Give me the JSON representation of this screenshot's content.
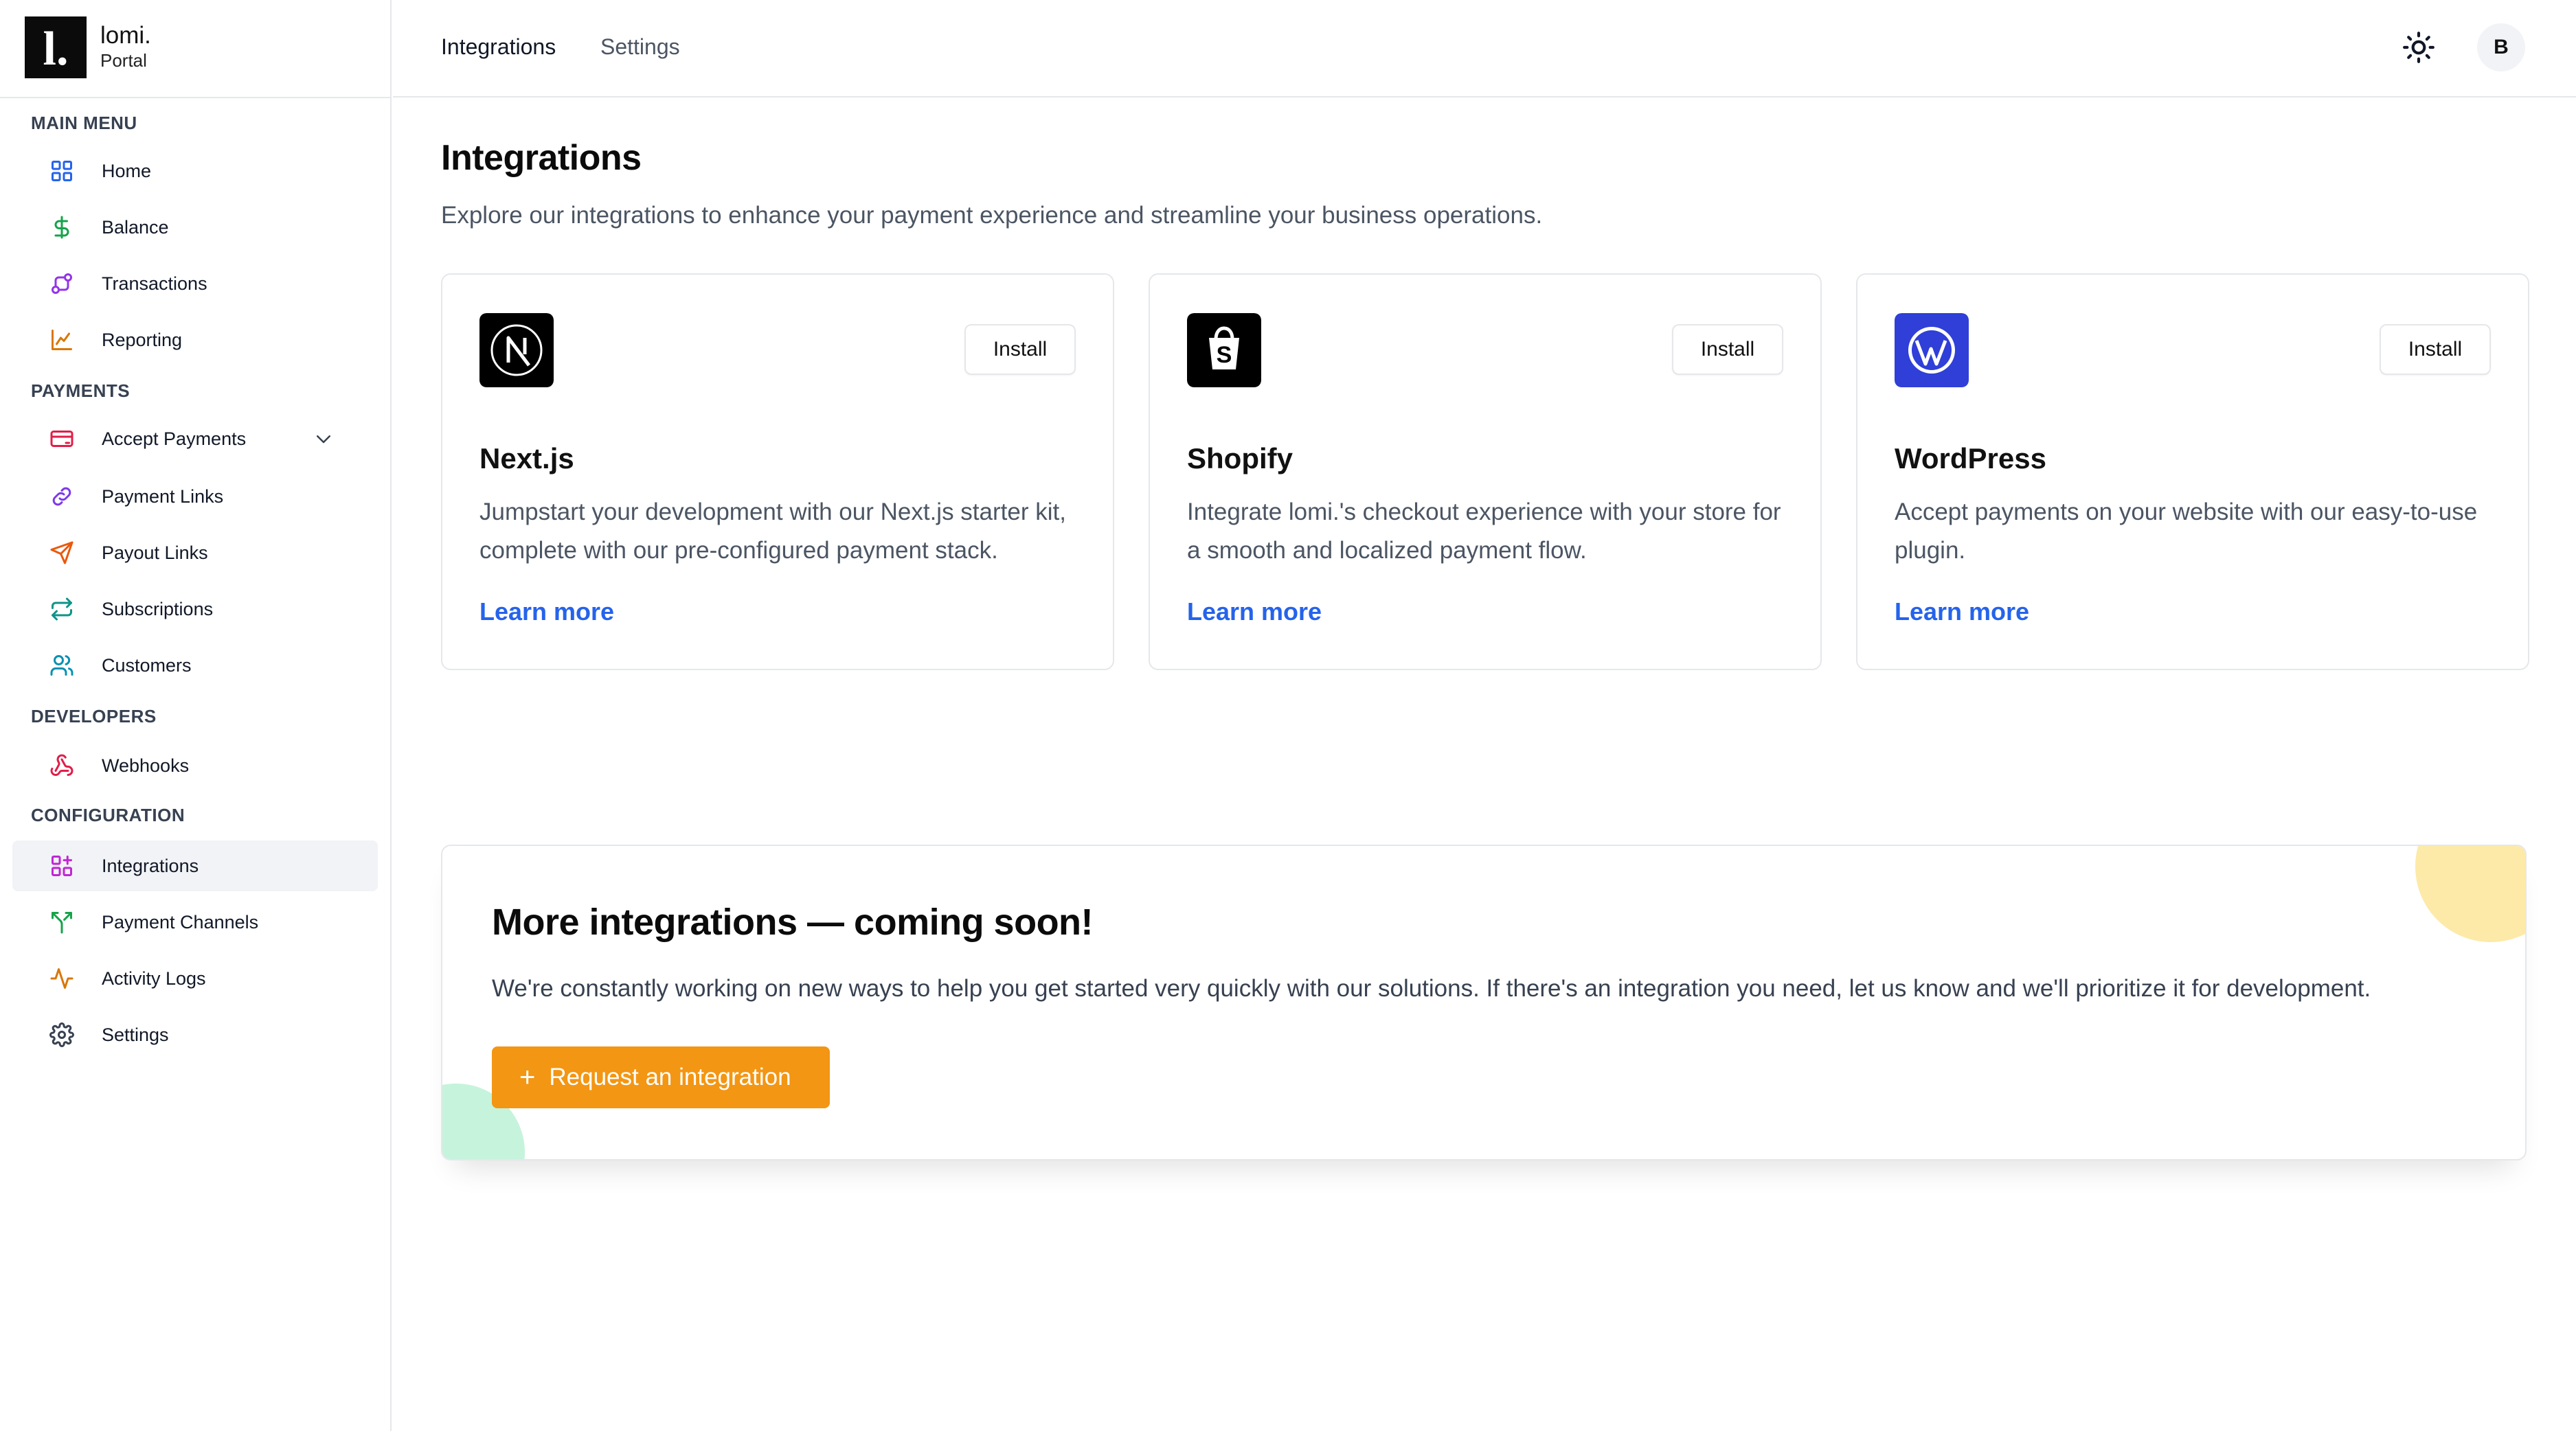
{
  "brand": {
    "logo_glyph": "l.",
    "name": "lomi.",
    "subtitle": "Portal"
  },
  "sidebar": {
    "sections": [
      {
        "label": "MAIN MENU"
      },
      {
        "label": "PAYMENTS"
      },
      {
        "label": "DEVELOPERS"
      },
      {
        "label": "CONFIGURATION"
      }
    ],
    "items": [
      {
        "label": "Home",
        "icon": "grid-icon",
        "color": "#2563eb"
      },
      {
        "label": "Balance",
        "icon": "dollar-icon",
        "color": "#16a34a"
      },
      {
        "label": "Transactions",
        "icon": "transactions-icon",
        "color": "#9333ea"
      },
      {
        "label": "Reporting",
        "icon": "chart-icon",
        "color": "#d97706"
      },
      {
        "label": "Accept Payments",
        "icon": "card-icon",
        "color": "#e11d48"
      },
      {
        "label": "Payment Links",
        "icon": "link-icon",
        "color": "#7c3aed"
      },
      {
        "label": "Payout Links",
        "icon": "send-icon",
        "color": "#ea580c"
      },
      {
        "label": "Subscriptions",
        "icon": "repeat-icon",
        "color": "#0d9488"
      },
      {
        "label": "Customers",
        "icon": "users-icon",
        "color": "#0891b2"
      },
      {
        "label": "Webhooks",
        "icon": "webhook-icon",
        "color": "#e11d48"
      },
      {
        "label": "Integrations",
        "icon": "integrations-icon",
        "color": "#c026d3"
      },
      {
        "label": "Payment Channels",
        "icon": "split-icon",
        "color": "#16a34a"
      },
      {
        "label": "Activity Logs",
        "icon": "activity-icon",
        "color": "#d97706"
      },
      {
        "label": "Settings",
        "icon": "gear-icon",
        "color": "#374151"
      }
    ]
  },
  "topbar": {
    "tabs": [
      {
        "label": "Integrations"
      },
      {
        "label": "Settings"
      }
    ],
    "avatar_initial": "B"
  },
  "main": {
    "title": "Integrations",
    "subtitle": "Explore our integrations to enhance your payment experience and streamline your business operations.",
    "cards": [
      {
        "title": "Next.js",
        "description": "Jumpstart your development with our Next.js starter kit, complete with our pre-configured payment stack.",
        "install_label": "Install",
        "link_label": "Learn more"
      },
      {
        "title": "Shopify",
        "description": "Integrate lomi.'s checkout experience with your store for a smooth and localized payment flow.",
        "install_label": "Install",
        "link_label": "Learn more"
      },
      {
        "title": "WordPress",
        "description": "Accept payments on your website with our easy-to-use plugin.",
        "install_label": "Install",
        "link_label": "Learn more"
      }
    ],
    "promo": {
      "title": "More integrations — coming soon!",
      "description": "We're constantly working on new ways to help you get started very quickly with our solutions. If there's an integration you need, let us know and we'll prioritize it for development.",
      "button_label": "Request an integration",
      "button_color": "#f39613"
    }
  }
}
